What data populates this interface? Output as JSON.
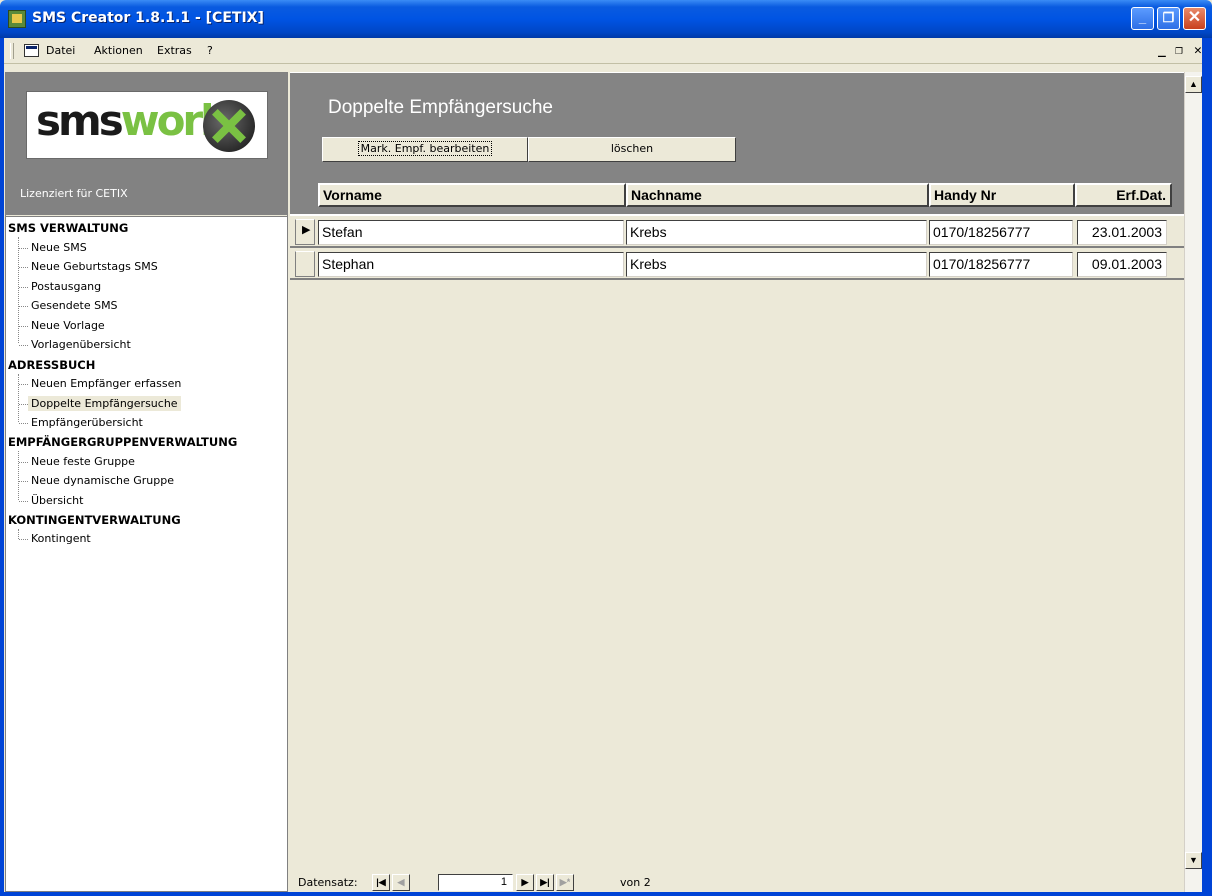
{
  "window": {
    "title": "SMS Creator 1.8.1.1 - [CETIX]",
    "min_glyph": "_",
    "max_glyph": "❐",
    "close_glyph": "✕"
  },
  "menubar": {
    "items": [
      "Datei",
      "Aktionen",
      "Extras",
      "?"
    ],
    "mdi_controls": [
      "_",
      "❐",
      "✕"
    ]
  },
  "sidebar": {
    "logo": {
      "part1": "sms",
      "part2": "work"
    },
    "licensed": "Lizenziert für CETIX",
    "sections": [
      {
        "title": "SMS VERWALTUNG",
        "items": [
          "Neue SMS",
          "Neue Geburtstags SMS",
          "Postausgang",
          "Gesendete SMS",
          "Neue Vorlage",
          "Vorlagenübersicht"
        ]
      },
      {
        "title": "ADRESSBUCH",
        "items": [
          "Neuen Empfänger erfassen",
          "Doppelte Empfängersuche",
          "Empfängerübersicht"
        ]
      },
      {
        "title": "EMPFÄNGERGRUPPENVERWALTUNG",
        "items": [
          "Neue feste Gruppe",
          "Neue dynamische Gruppe",
          "Übersicht"
        ]
      },
      {
        "title": "KONTINGENTVERWALTUNG",
        "items": [
          "Kontingent"
        ]
      }
    ],
    "selected_item": "Doppelte Empfängersuche"
  },
  "main": {
    "title": "Doppelte Empfängersuche",
    "buttons": {
      "edit": "Mark. Empf. bearbeiten",
      "delete": "löschen"
    },
    "columns": [
      "Vorname",
      "Nachname",
      "Handy Nr",
      "Erf.Dat."
    ],
    "rows": [
      {
        "vorname": "Stefan",
        "nachname": "Krebs",
        "handy": "0170/18256777",
        "datum": "23.01.2003"
      },
      {
        "vorname": "Stephan",
        "nachname": "Krebs",
        "handy": "0170/18256777",
        "datum": "09.01.2003"
      }
    ],
    "record_nav": {
      "label": "Datensatz:",
      "current": "1",
      "of_label": "von 2",
      "first": "|◀",
      "prev": "◀",
      "next": "▶",
      "last": "▶|",
      "new": "▶*"
    }
  },
  "colors": {
    "title_bar": "#0054e3",
    "main_bg": "#848484",
    "logo_green": "#7ac143"
  }
}
